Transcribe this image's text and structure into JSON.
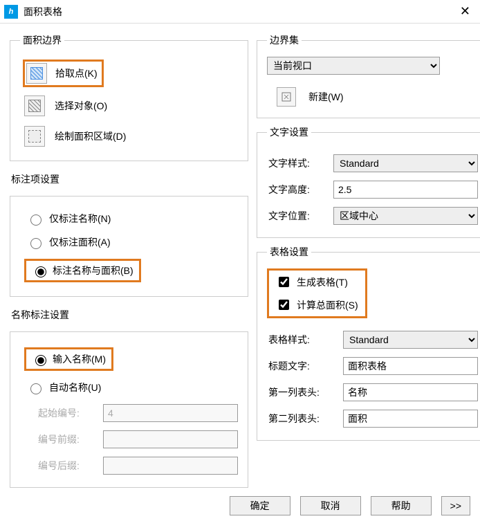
{
  "title": "面积表格",
  "boundary": {
    "legend": "面积边界",
    "pick_point": "拾取点(K)",
    "select_obj": "选择对象(O)",
    "draw_area": "绘制面积区域(D)"
  },
  "annotation": {
    "title": "标注项设置",
    "name_only": "仅标注名称(N)",
    "area_only": "仅标注面积(A)",
    "name_and_area": "标注名称与面积(B)"
  },
  "naming": {
    "title": "名称标注设置",
    "input_name": "输入名称(M)",
    "auto_name": "自动名称(U)",
    "start_num_label": "起始编号:",
    "start_num": "4",
    "prefix_label": "编号前缀:",
    "prefix": "",
    "suffix_label": "编号后缀:",
    "suffix": ""
  },
  "boundary_set": {
    "legend": "边界集",
    "current_viewport": "当前视口",
    "new": "新建(W)"
  },
  "text": {
    "legend": "文字设置",
    "style_label": "文字样式:",
    "style": "Standard",
    "height_label": "文字高度:",
    "height": "2.5",
    "pos_label": "文字位置:",
    "pos": "区域中心"
  },
  "table": {
    "legend": "表格设置",
    "gen_table": "生成表格(T)",
    "calc_total": "计算总面积(S)",
    "style_label": "表格样式:",
    "style": "Standard",
    "title_label": "标题文字:",
    "title": "面积表格",
    "col1_label": "第一列表头:",
    "col1": "名称",
    "col2_label": "第二列表头:",
    "col2": "面积"
  },
  "footer": {
    "ok": "确定",
    "cancel": "取消",
    "help": "帮助",
    "expand": ">>"
  }
}
